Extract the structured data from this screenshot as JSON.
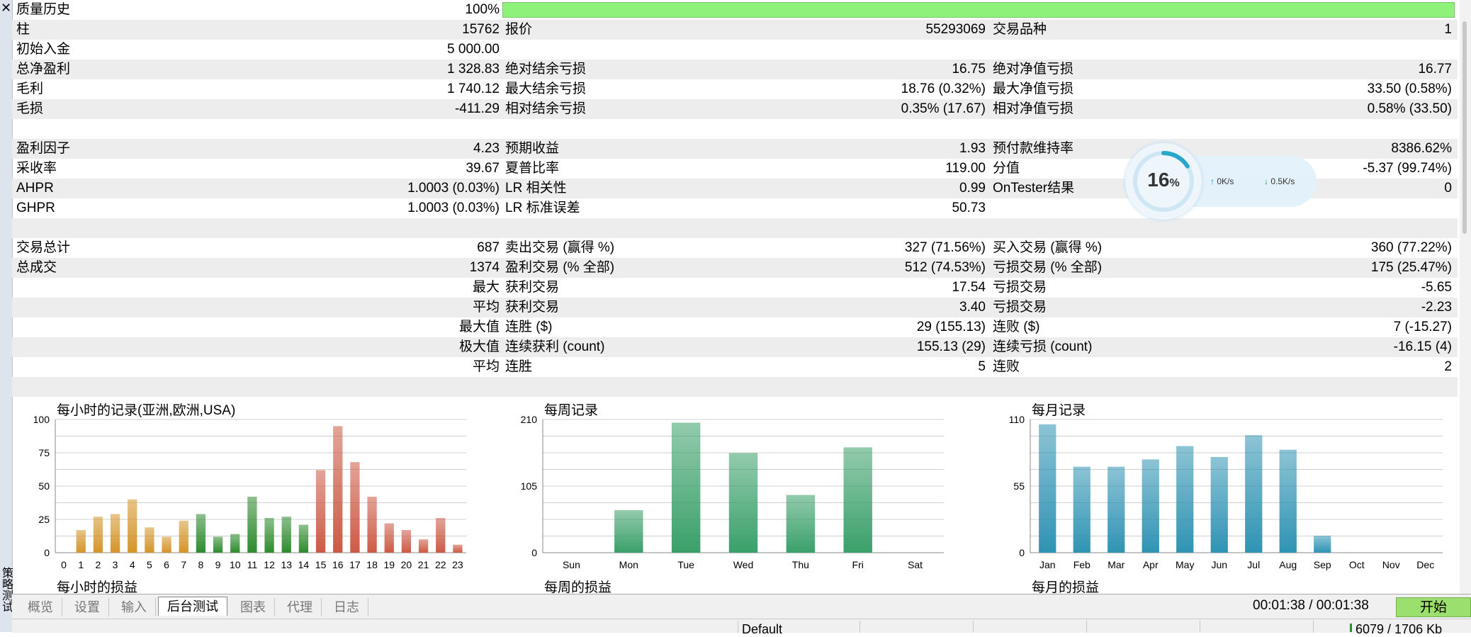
{
  "stats_rows": [
    {
      "shaded": false,
      "top": 0,
      "cells": [
        {
          "key": "质量历史",
          "value": "100%",
          "bar": true
        }
      ]
    },
    {
      "shaded": true,
      "cells": [
        {
          "key": "柱",
          "value": "15762"
        },
        {
          "key": "报价",
          "value": "55293069"
        },
        {
          "key": "交易品种",
          "value": "1"
        }
      ]
    },
    {
      "shaded": false,
      "cells": [
        {
          "key": "初始入金",
          "value": "5 000.00"
        }
      ]
    },
    {
      "shaded": true,
      "cells": [
        {
          "key": "总净盈利",
          "value": "1 328.83"
        },
        {
          "key": "绝对结余亏损",
          "value": "16.75"
        },
        {
          "key": "绝对净值亏损",
          "value": "16.77"
        }
      ]
    },
    {
      "shaded": false,
      "cells": [
        {
          "key": "毛利",
          "value": "1 740.12"
        },
        {
          "key": "最大结余亏损",
          "value": "18.76 (0.32%)"
        },
        {
          "key": "最大净值亏损",
          "value": "33.50 (0.58%)"
        }
      ]
    },
    {
      "shaded": true,
      "cells": [
        {
          "key": "毛损",
          "value": "-411.29"
        },
        {
          "key": "相对结余亏损",
          "value": "0.35% (17.67)"
        },
        {
          "key": "相对净值亏损",
          "value": "0.58% (33.50)"
        }
      ]
    },
    {
      "shaded": false,
      "cells": []
    },
    {
      "shaded": true,
      "cells": [
        {
          "key": "盈利因子",
          "value": "4.23"
        },
        {
          "key": "预期收益",
          "value": "1.93"
        },
        {
          "key": "预付款维持率",
          "value": "8386.62%"
        }
      ]
    },
    {
      "shaded": false,
      "cells": [
        {
          "key": "采收率",
          "value": "39.67"
        },
        {
          "key": "夏普比率",
          "value": "119.00"
        },
        {
          "key": "分值",
          "value": "-5.37 (99.74%)"
        }
      ]
    },
    {
      "shaded": true,
      "cells": [
        {
          "key": "AHPR",
          "value": "1.0003 (0.03%)"
        },
        {
          "key": "LR 相关性",
          "value": "0.99"
        },
        {
          "key": "OnTester结果",
          "value": "0"
        }
      ]
    },
    {
      "shaded": false,
      "cells": [
        {
          "key": "GHPR",
          "value": "1.0003 (0.03%)"
        },
        {
          "key": "LR 标准误差",
          "value": "50.73"
        }
      ]
    },
    {
      "shaded": true,
      "cells": []
    },
    {
      "shaded": false,
      "cells": [
        {
          "key": "交易总计",
          "value": "687"
        },
        {
          "key": "卖出交易 (赢得 %)",
          "value": "327 (71.56%)"
        },
        {
          "key": "买入交易 (赢得 %)",
          "value": "360 (77.22%)"
        }
      ]
    },
    {
      "shaded": true,
      "cells": [
        {
          "key": "总成交",
          "value": "1374"
        },
        {
          "key": "盈利交易 (% 全部)",
          "value": "512 (74.53%)"
        },
        {
          "key": "亏损交易 (% 全部)",
          "value": "175 (25.47%)"
        }
      ]
    },
    {
      "shaded": false,
      "cells": [
        {
          "key": "",
          "value": "最大"
        },
        {
          "key": "获利交易",
          "value": "17.54"
        },
        {
          "key": "亏损交易",
          "value": "-5.65"
        }
      ]
    },
    {
      "shaded": true,
      "cells": [
        {
          "key": "",
          "value": "平均"
        },
        {
          "key": "获利交易",
          "value": "3.40"
        },
        {
          "key": "亏损交易",
          "value": "-2.23"
        }
      ]
    },
    {
      "shaded": false,
      "cells": [
        {
          "key": "",
          "value": "最大值"
        },
        {
          "key": "连胜 ($)",
          "value": "29 (155.13)"
        },
        {
          "key": "连败 ($)",
          "value": "7 (-15.27)"
        }
      ]
    },
    {
      "shaded": true,
      "cells": [
        {
          "key": "",
          "value": "极大值"
        },
        {
          "key": "连续获利 (count)",
          "value": "155.13 (29)"
        },
        {
          "key": "连续亏损 (count)",
          "value": "-16.15 (4)"
        }
      ]
    },
    {
      "shaded": false,
      "cells": [
        {
          "key": "",
          "value": "平均"
        },
        {
          "key": "连胜",
          "value": "5"
        },
        {
          "key": "连败",
          "value": "2"
        }
      ]
    },
    {
      "shaded": true,
      "cells": []
    }
  ],
  "speed_widget": {
    "percent": "16",
    "percent_sign": "%",
    "level": 0.16,
    "upload": "0K/s",
    "download": "0.5K/s"
  },
  "chart_data": [
    {
      "type": "bar",
      "title": "每小时的记录(亚洲,欧洲,USA)",
      "subtitle": "每小时的损益",
      "categories": [
        "0",
        "1",
        "2",
        "3",
        "4",
        "5",
        "6",
        "7",
        "8",
        "9",
        "10",
        "11",
        "12",
        "13",
        "14",
        "15",
        "16",
        "17",
        "18",
        "19",
        "20",
        "21",
        "22",
        "23"
      ],
      "values": [
        0,
        17,
        27,
        29,
        40,
        19,
        12,
        24,
        29,
        12,
        14,
        42,
        26,
        27,
        21,
        62,
        95,
        68,
        42,
        22,
        17,
        10,
        26,
        6
      ],
      "ylim": [
        0,
        100
      ],
      "yticks": [
        "0",
        "25",
        "50",
        "75",
        "100"
      ],
      "colors": [
        "#d4952a",
        "#d4952a",
        "#d4952a",
        "#d4952a",
        "#d4952a",
        "#d4952a",
        "#d4952a",
        "#d4952a",
        "#2e8b2e",
        "#2e8b2e",
        "#2e8b2e",
        "#2e8b2e",
        "#2e8b2e",
        "#2e8b2e",
        "#2e8b2e",
        "#cc5a45",
        "#cc5a45",
        "#cc5a45",
        "#cc5a45",
        "#cc5a45",
        "#cc5a45",
        "#cc5a45",
        "#cc5a45",
        "#cc5a45"
      ],
      "grid": true
    },
    {
      "type": "bar",
      "title": "每周记录",
      "subtitle": "每周的损益",
      "categories": [
        "Sun",
        "Mon",
        "Tue",
        "Wed",
        "Thu",
        "Fri",
        "Sat"
      ],
      "values": [
        0,
        67,
        205,
        157,
        91,
        166,
        0
      ],
      "ylim": [
        0,
        210
      ],
      "yticks": [
        "0",
        "105",
        "210"
      ],
      "colors": [
        "#3aa06a",
        "#3aa06a",
        "#3aa06a",
        "#3aa06a",
        "#3aa06a",
        "#3aa06a",
        "#3aa06a"
      ],
      "grid": true
    },
    {
      "type": "bar",
      "title": "每月记录",
      "subtitle": "每月的损益",
      "categories": [
        "Jan",
        "Feb",
        "Mar",
        "Apr",
        "May",
        "Jun",
        "Jul",
        "Aug",
        "Sep",
        "Oct",
        "Nov",
        "Dec"
      ],
      "values": [
        106,
        71,
        71,
        77,
        88,
        79,
        97,
        85,
        14,
        0,
        0,
        0
      ],
      "ylim": [
        0,
        110
      ],
      "yticks": [
        "0",
        "55",
        "110"
      ],
      "colors": [
        "#2f93b3",
        "#2f93b3",
        "#2f93b3",
        "#2f93b3",
        "#2f93b3",
        "#2f93b3",
        "#2f93b3",
        "#2f93b3",
        "#2f93b3",
        "#2f93b3",
        "#2f93b3",
        "#2f93b3"
      ],
      "grid": true
    }
  ],
  "tabs": [
    {
      "label": "概览",
      "active": false
    },
    {
      "label": "设置",
      "active": false
    },
    {
      "label": "输入",
      "active": false
    },
    {
      "label": "后台测试",
      "active": true
    },
    {
      "label": "图表",
      "active": false
    },
    {
      "label": "代理",
      "active": false
    },
    {
      "label": "日志",
      "active": false
    }
  ],
  "timer": "00:01:38 / 00:01:38",
  "start_button": "开始",
  "status_bar": {
    "profile": "Default",
    "memory": "6079 / 1706 Kb"
  },
  "left_panel": {
    "vertical_label": "策略测试",
    "close_glyph": "✕"
  }
}
